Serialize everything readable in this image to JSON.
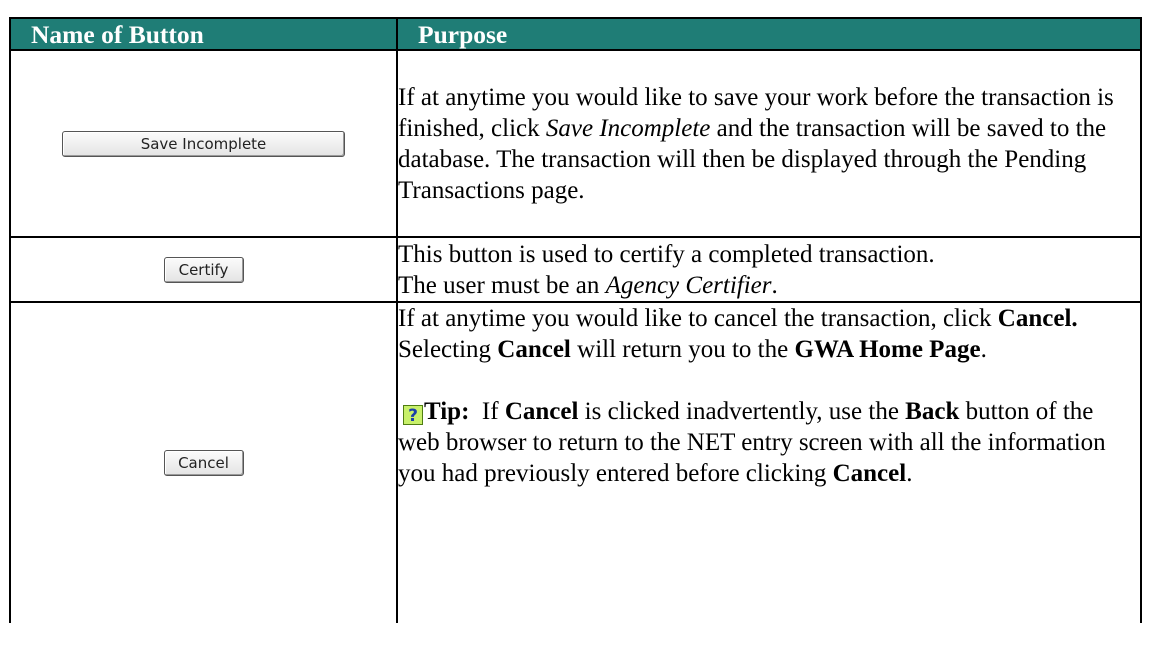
{
  "table": {
    "header": {
      "name_col": "Name of Button",
      "purpose_col": "Purpose"
    },
    "colors": {
      "header_bg": "#1f7d76",
      "header_text": "#ffffff",
      "tip_icon_bg": "#c8f06a"
    },
    "rows": [
      {
        "button_label": "Save Incomplete",
        "purpose": {
          "t1": "If at anytime you would like to save your work before the transaction is finished, click ",
          "t2": "Save Incomplete",
          "t3": " and the transaction will be saved to the database. The transaction will then be displayed through the Pending Transactions page."
        }
      },
      {
        "button_label": "Certify",
        "purpose": {
          "t1": "This button is used to certify a completed transaction.",
          "t2": " The user must be an ",
          "t3": "Agency Certifier",
          "t4": "."
        }
      },
      {
        "button_label": "Cancel",
        "purpose": {
          "p1_t1": "If at anytime you would like to cancel the transaction, click ",
          "p1_t2": "Cancel.",
          "p1_t3": " Selecting ",
          "p1_t4": "Cancel",
          "p1_t5": " will return you to the ",
          "p1_t6": "GWA Home Page",
          "p1_t7": ".",
          "tip_icon_glyph": "?",
          "tip_label": "Tip:",
          "tip_t1": "  If ",
          "tip_t2": "Cancel",
          "tip_t3": " is clicked inadvertently, use the ",
          "tip_t4": "Back",
          "tip_t5": " button of the web browser to return to the NET entry screen with all the information you had previously entered before clicking ",
          "tip_t6": "Cancel",
          "tip_t7": "."
        }
      }
    ]
  },
  "icons": {
    "tip": "help-question-icon"
  }
}
